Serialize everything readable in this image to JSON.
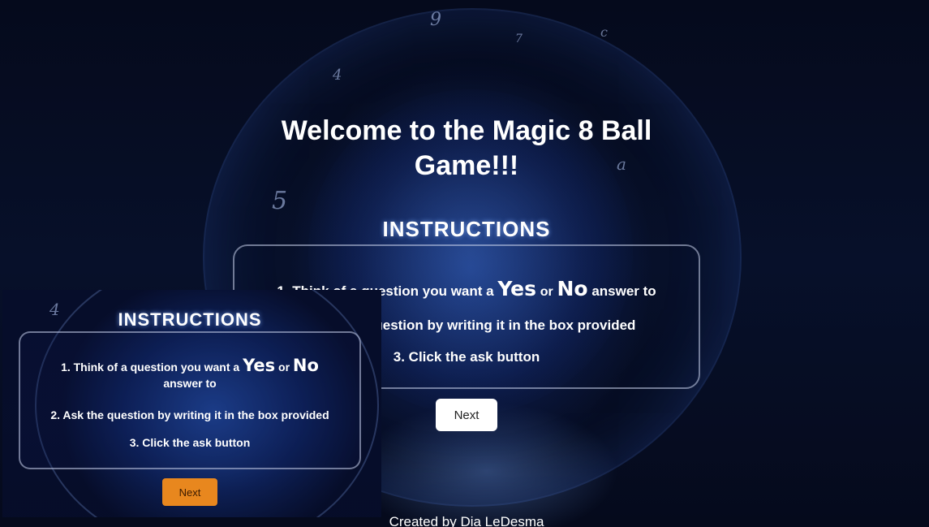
{
  "page": {
    "title": "Welcome to the Magic 8 Ball Game!!!",
    "footer": "Created by Dia LeDesma"
  },
  "instructions": {
    "heading": "INSTRUCTIONS",
    "step1_prefix": "1. Think of a question you want a",
    "yes": "Yes",
    "or": "or",
    "no": "No",
    "step1_suffix": "answer to",
    "step2": "2. Ask the question by writing it in the box provided",
    "step3": "3. Click the ask button",
    "next_label": "Next"
  },
  "preview": {
    "heading": "INSTRUCTIONS",
    "step1_prefix": "1. Think of a question you want a",
    "yes": "Yes",
    "or": "or",
    "no": "No",
    "step1_suffix": "answer to",
    "step2": "2. Ask the question by writing it in the box provided",
    "step3": "3. Click the ask button",
    "next_label": "Next"
  },
  "colors": {
    "background": "#07102a",
    "next_button": "#ffffff",
    "preview_next_button": "#e8871e"
  }
}
